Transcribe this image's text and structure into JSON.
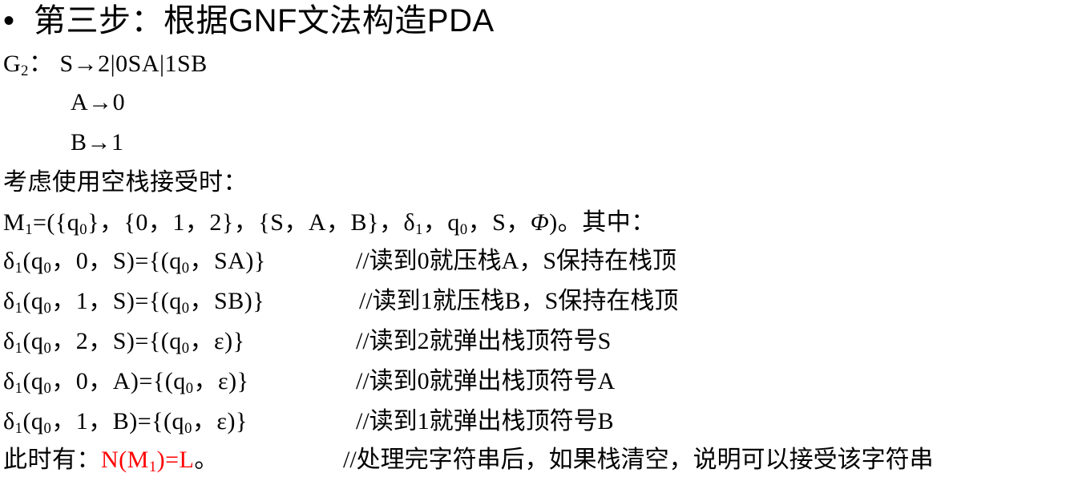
{
  "title": {
    "bullet": "•",
    "text": "第三步：根据GNF文法构造PDA"
  },
  "grammar": {
    "name": "G",
    "name_sub": "2",
    "sep": "：",
    "rule_s": "S→2|0SA|1SB",
    "rule_a": "A→0",
    "rule_b": "B→1"
  },
  "empty_stack_label": "考虑使用空栈接受时：",
  "machine": {
    "prefix": "M",
    "prefix_sub": "1",
    "part1": "=({q",
    "part1_sub": "0",
    "part2": "}，{0，1，2}，{S，A，B}，δ",
    "part2_sub": "1",
    "part3": "，q",
    "part3_sub": "0",
    "part4": "，S，",
    "phi": "Φ",
    "part5": ")。其中："
  },
  "transitions": [
    {
      "delta_sub": "1",
      "input": "0",
      "stack": "S",
      "result": "SA)}",
      "comment": "//读到0就压栈A，S保持在栈顶"
    },
    {
      "delta_sub": "1",
      "input": "1",
      "stack": "S",
      "result": "SB)}",
      "comment": "//读到1就压栈B，S保持在栈顶"
    },
    {
      "delta_sub": "1",
      "input": "2",
      "stack": "S",
      "result": "ε)}",
      "comment": "//读到2就弹出栈顶符号S"
    },
    {
      "delta_sub": "1",
      "input": "0",
      "stack": "A",
      "result": "ε)}",
      "comment": "//读到0就弹出栈顶符号A"
    },
    {
      "delta_sub": "1",
      "input": "1",
      "stack": "B",
      "result": "ε)}",
      "comment": "//读到1就弹出栈顶符号B"
    }
  ],
  "conclusion": {
    "label": "此时有：",
    "eq_prefix": "N(M",
    "eq_sub": "1",
    "eq_suffix": ")=L",
    "period": "。",
    "comment": "//处理完字符串后，如果栈清空，说明可以接受该字符串"
  },
  "colors": {
    "highlight": "#ff0000",
    "text": "#000000"
  }
}
